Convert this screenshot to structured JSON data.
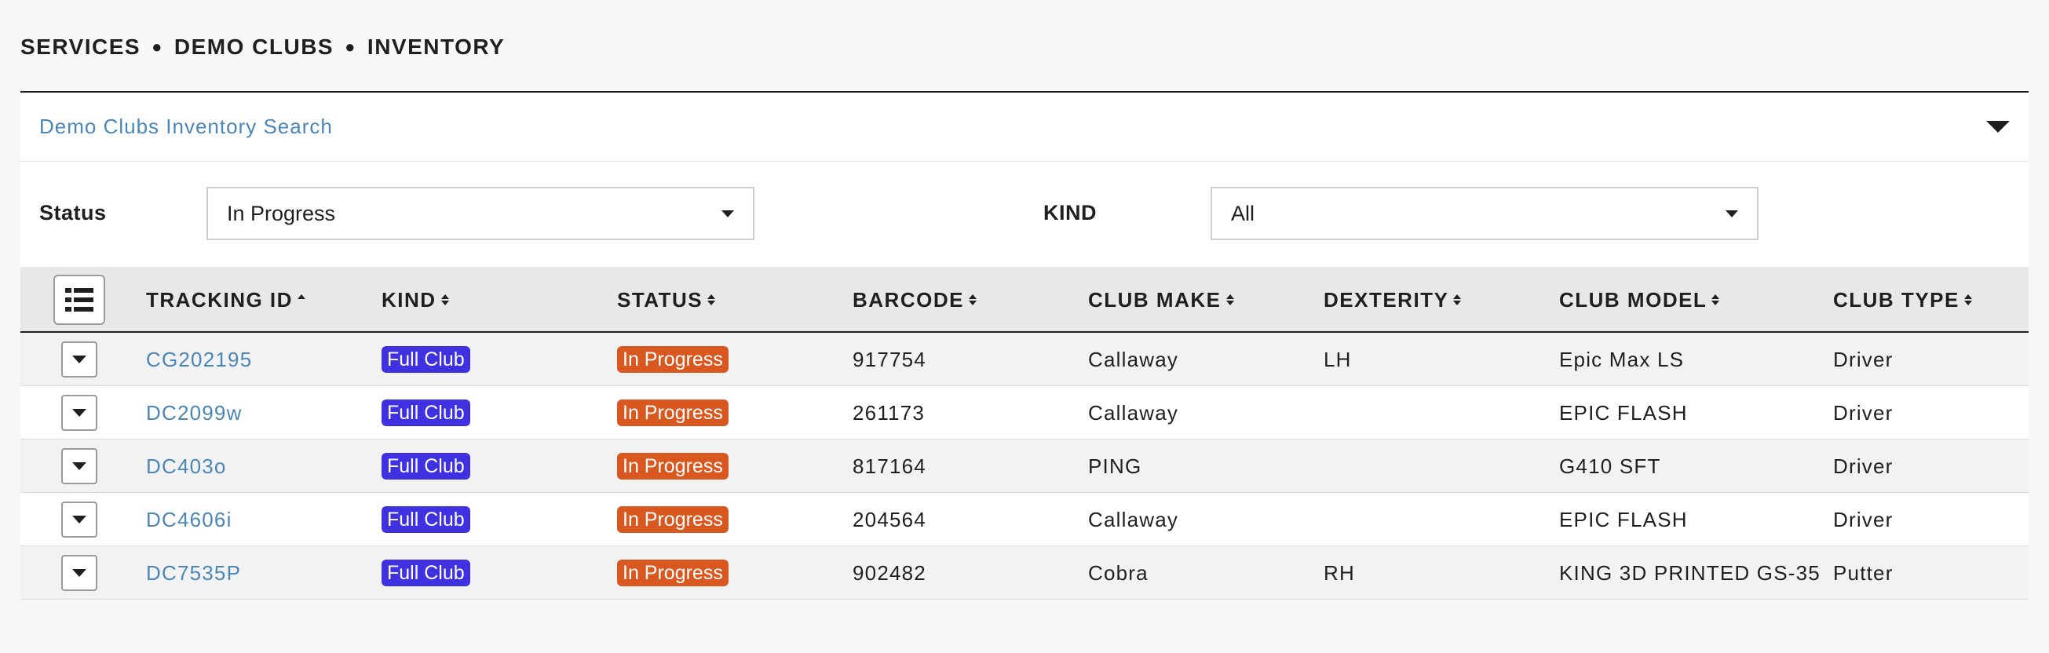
{
  "breadcrumb": {
    "part1": "SERVICES",
    "part2": "DEMO CLUBS",
    "part3": "INVENTORY",
    "separator": "●"
  },
  "search_panel": {
    "title": "Demo Clubs Inventory Search",
    "status_label": "Status",
    "status_value": "In Progress",
    "kind_label": "KIND",
    "kind_value": "All"
  },
  "table": {
    "columns": {
      "tracking_id": "TRACKING ID",
      "kind": "KIND",
      "status": "STATUS",
      "barcode": "BARCODE",
      "club_make": "CLUB MAKE",
      "dexterity": "DEXTERITY",
      "club_model": "CLUB MODEL",
      "club_type": "CLUB TYPE"
    },
    "sorted_column": "tracking_id",
    "sort_direction": "ascending",
    "rows": [
      {
        "tracking_id": "CG202195",
        "kind": "Full Club",
        "status": "In Progress",
        "barcode": "917754",
        "club_make": "Callaway",
        "dexterity": "LH",
        "club_model": "Epic Max LS",
        "club_type": "Driver"
      },
      {
        "tracking_id": "DC2099w",
        "kind": "Full Club",
        "status": "In Progress",
        "barcode": "261173",
        "club_make": "Callaway",
        "dexterity": "",
        "club_model": "EPIC FLASH",
        "club_type": "Driver"
      },
      {
        "tracking_id": "DC403o",
        "kind": "Full Club",
        "status": "In Progress",
        "barcode": "817164",
        "club_make": "PING",
        "dexterity": "",
        "club_model": "G410 SFT",
        "club_type": "Driver"
      },
      {
        "tracking_id": "DC4606i",
        "kind": "Full Club",
        "status": "In Progress",
        "barcode": "204564",
        "club_make": "Callaway",
        "dexterity": "",
        "club_model": "EPIC FLASH",
        "club_type": "Driver"
      },
      {
        "tracking_id": "DC7535P",
        "kind": "Full Club",
        "status": "In Progress",
        "barcode": "902482",
        "club_make": "Cobra",
        "dexterity": "RH",
        "club_model": "KING 3D PRINTED GS-35",
        "club_type": "Putter"
      }
    ]
  },
  "icons": {
    "panel_toggle": "chevron-down-icon",
    "column_picker": "list-icon",
    "row_expand": "chevron-down-icon",
    "dropdown": "caret-down-icon",
    "sort": "sort-icon"
  },
  "colors": {
    "link": "#4a86b8",
    "kind_badge": "#3f31e0",
    "status_badge": "#d9581f",
    "header_bg": "#e8e8e8"
  }
}
